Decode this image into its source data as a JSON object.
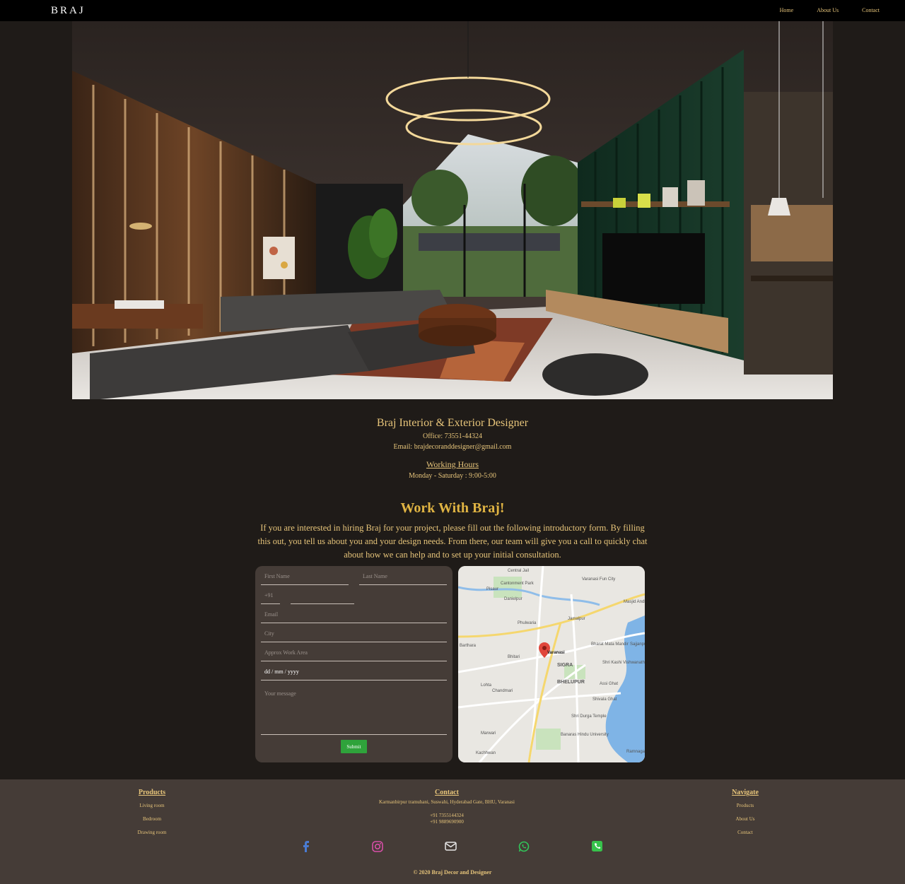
{
  "nav": {
    "brand": "BRAJ",
    "links": [
      "Home",
      "About Us",
      "Contact"
    ]
  },
  "info": {
    "company": "Braj Interior & Exterior Designer",
    "office": "Office: 73551-44324",
    "email": "Email: brajdecoranddesigner@gmail.com",
    "hours_title": "Working Hours",
    "hours": "Monday - Saturday : 9:00-5:00"
  },
  "work": {
    "title": "Work With Braj!",
    "description": "If you are interested in hiring Braj for your project, please fill out the following introductory form. By filling this out, you tell us about you and your design needs. From there, our team will give you a call to quickly chat about how we can help and to set up your initial consultation."
  },
  "form": {
    "first_name": "First Name",
    "last_name": "Last Name",
    "country_code": "+91",
    "email": "Email",
    "city": "City",
    "work_area": "Approx Work Area",
    "date": "dd / mm / yyyy",
    "message": "Your message",
    "submit": "Submit"
  },
  "map": {
    "labels": [
      "Central Jail",
      "Varanasi Fun City",
      "Pisaur",
      "Cantonment Park",
      "Danielpur",
      "Phulwaria",
      "Jamalpur",
      "Bharat Mata Mandir",
      "Varanasi",
      "Barthara",
      "Bhitari",
      "SIGRA",
      "Shri Kashi Vishwanath Temple",
      "BHELUPUR",
      "Lohta",
      "Chandmari",
      "Assi Ghat",
      "Shivala Ghat",
      "Shri Durga Temple",
      "Marwari",
      "Banaras Hindu University",
      "Kachhwan",
      "Ramnagar",
      "Sajjanpur",
      "Masjid Andh"
    ]
  },
  "footer": {
    "products_title": "Products",
    "products": [
      "Living room",
      "Bedroom",
      "Drawing room"
    ],
    "contact_title": "Contact",
    "address": "Karmanbirpur tramuhani, Suswahi, Hyderabad Gate, BHU, Varanasi",
    "phone1": "+91 7355144324",
    "phone2": "+91 9889690900",
    "navigate_title": "Navigate",
    "navigate": [
      "Products",
      "About Us",
      "Contact"
    ],
    "copyright": "© 2020 Braj Decor and Designer"
  },
  "social_icons": [
    "facebook-icon",
    "instagram-icon",
    "envelope-icon",
    "whatsapp-icon",
    "phone-icon"
  ],
  "colors": {
    "accent": "#e6c47a",
    "background": "#1f1b18",
    "card": "#453c37",
    "submit": "#2fa33b",
    "facebook": "#4a7bd1",
    "instagram": "#d84fa8",
    "mail": "#e6e6e6",
    "whatsapp": "#31c75a",
    "phone": "#37c24b"
  }
}
